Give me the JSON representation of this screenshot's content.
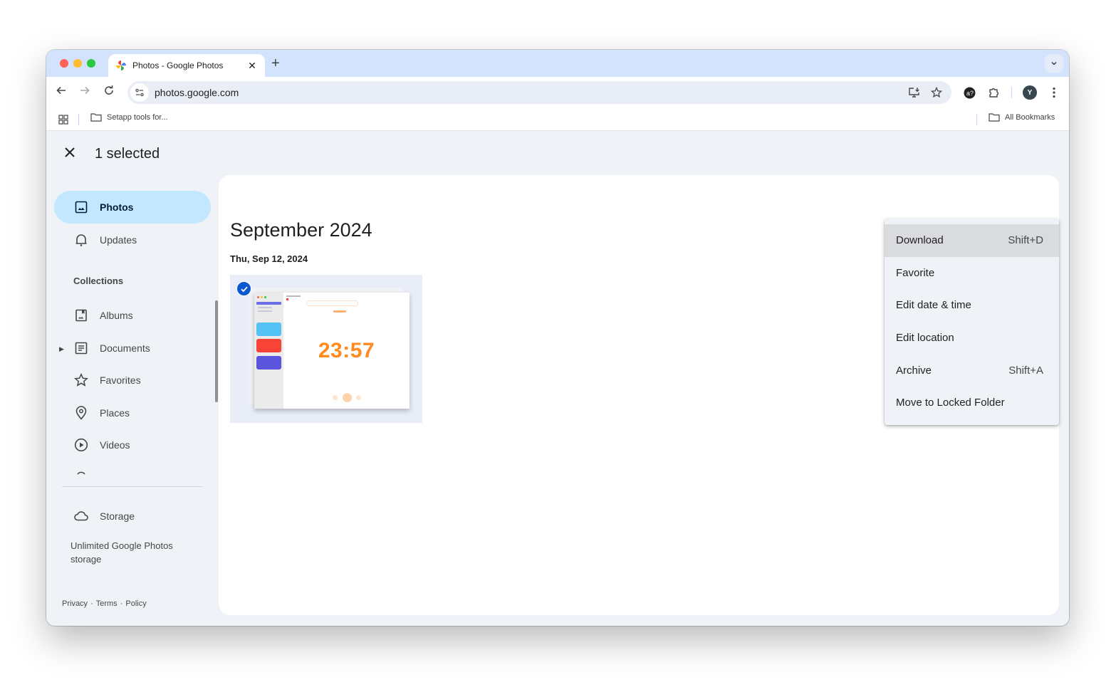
{
  "browser": {
    "tab": {
      "title": "Photos - Google Photos",
      "favicon": "google-photos-pinwheel-icon"
    },
    "new_tab_label": "+",
    "address": {
      "url": "photos.google.com"
    },
    "toolbar_icons": [
      "back-icon",
      "forward-icon",
      "reload-icon",
      "site-info-icon",
      "install-app-icon",
      "bookmark-star-icon",
      "extension-a-icon",
      "extensions-puzzle-icon",
      "profile-avatar",
      "more-menu-icon"
    ],
    "profile_initial": "Y",
    "bookmarks": {
      "items": [
        {
          "label": "Setapp tools for..."
        }
      ],
      "all_bookmarks_label": "All Bookmarks"
    }
  },
  "app": {
    "selection": {
      "label": "1 selected"
    },
    "sidebar": {
      "items": [
        {
          "label": "Photos",
          "icon": "photo-icon",
          "active": true
        },
        {
          "label": "Updates",
          "icon": "bell-icon",
          "active": false
        }
      ],
      "collections_label": "Collections",
      "collections": [
        {
          "label": "Albums",
          "icon": "album-icon"
        },
        {
          "label": "Documents",
          "icon": "document-icon",
          "expandable": true
        },
        {
          "label": "Favorites",
          "icon": "star-icon"
        },
        {
          "label": "Places",
          "icon": "location-pin-icon"
        },
        {
          "label": "Videos",
          "icon": "play-circle-icon"
        }
      ],
      "storage": {
        "label": "Storage",
        "icon": "cloud-icon",
        "description": "Unlimited Google Photos storage"
      },
      "footer": {
        "privacy": "Privacy",
        "terms": "Terms",
        "policy": "Policy",
        "separator": "·"
      }
    },
    "content": {
      "month_heading": "September 2024",
      "day_heading": "Thu, Sep 12, 2024",
      "photos": [
        {
          "selected": true,
          "preview_text": "23:57",
          "preview_accent": "#ff8a1e"
        }
      ]
    },
    "menu": {
      "items": [
        {
          "label": "Download",
          "shortcut": "Shift+D",
          "highlighted": true
        },
        {
          "label": "Favorite",
          "shortcut": ""
        },
        {
          "label": "Edit date & time",
          "shortcut": ""
        },
        {
          "label": "Edit location",
          "shortcut": ""
        },
        {
          "label": "Archive",
          "shortcut": "Shift+A"
        },
        {
          "label": "Move to Locked Folder",
          "shortcut": ""
        }
      ]
    }
  },
  "colors": {
    "tabstrip": "#d3e3fd",
    "app_bg": "#eff3f8",
    "active_nav": "#c2e7ff",
    "check_blue": "#0b57d0",
    "menu_highlight": "#dadbde"
  }
}
